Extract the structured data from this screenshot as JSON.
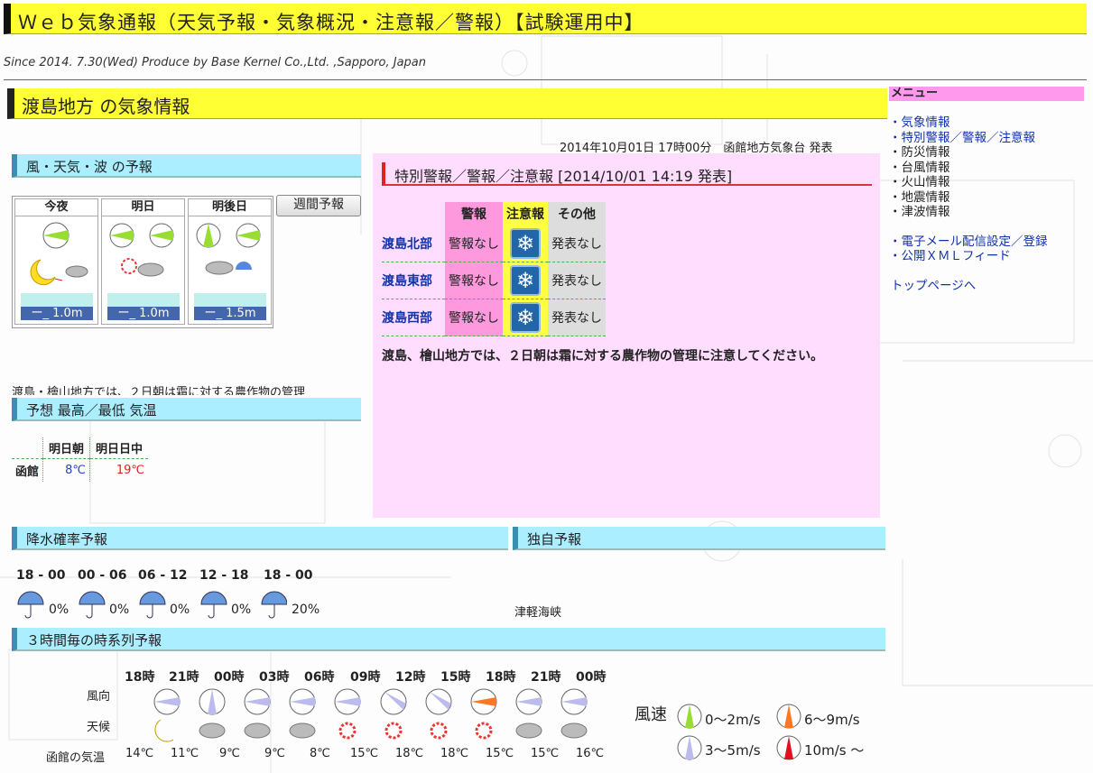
{
  "header": {
    "title": "Ｗｅｂ気象通報（天気予報・気象概況・注意報／警報）【試験運用中】",
    "subtitle": "Since 2014. 7.30(Wed) Produce by Base Kernel Co.,Ltd. ,Sapporo, Japan"
  },
  "region": {
    "title": "渡島地方 の気象情報",
    "issued": "2014年10月01日 17時00分　函館地方気象台 発表"
  },
  "menu": {
    "title": "メニュー",
    "items": [
      "・気象情報",
      "・特別警報／警報／注意報",
      "・防災情報",
      "・台風情報",
      "・火山情報",
      "・地震情報",
      "・津波情報"
    ],
    "links2": [
      "・電子メール配信設定／登録",
      "・公開ＸＭＬフィード"
    ],
    "top_link": "トップページへ"
  },
  "forecast": {
    "title": "風・天気・波 の予報",
    "week_button": "週間予報",
    "days": [
      {
        "label": "今夜",
        "wave": "1.0m",
        "weather": "moon-cloud"
      },
      {
        "label": "明日",
        "wave": "1.0m",
        "weather": "sun-cloud"
      },
      {
        "label": "明後日",
        "wave": "1.5m",
        "weather": "cloud-rain"
      }
    ],
    "cut_text": "渡島・檜山地方では、２日朝は霜に対する農作物の管理"
  },
  "warnings": {
    "title": "特別警報／警報／注意報 [2014/10/01 14:19 発表]",
    "headers": [
      "警報",
      "注意報",
      "その他"
    ],
    "rows": [
      {
        "area": "渡島北部",
        "warning": "警報なし",
        "other": "発表なし"
      },
      {
        "area": "渡島東部",
        "warning": "警報なし",
        "other": "発表なし"
      },
      {
        "area": "渡島西部",
        "warning": "警報なし",
        "other": "発表なし"
      }
    ],
    "note": "渡島、檜山地方では、２日朝は霜に対する農作物の管理に注意してください。"
  },
  "temps": {
    "title": "予想 最高／最低 気温",
    "headers": [
      "明日朝",
      "明日日中"
    ],
    "city": "函館",
    "min": "8℃",
    "max": "19℃"
  },
  "pop": {
    "title": "降水確率予報",
    "periods": [
      "18 - 00",
      "00 - 06",
      "06 - 12",
      "12 - 18",
      "18 - 00"
    ],
    "values": [
      "0%",
      "0%",
      "0%",
      "0%",
      "20%"
    ]
  },
  "own": {
    "title": "独自予報",
    "text": "津軽海峡"
  },
  "series": {
    "title": "３時間毎の時系列予報",
    "row_labels": [
      "風向",
      "天候",
      "函館の気温"
    ],
    "hours": [
      "18時",
      "21時",
      "00時",
      "03時",
      "06時",
      "09時",
      "12時",
      "15時",
      "18時",
      "21時",
      "00時"
    ],
    "temps": [
      "14℃",
      "11℃",
      "9℃",
      "9℃",
      "8℃",
      "15℃",
      "18℃",
      "18℃",
      "15℃",
      "15℃",
      "16℃"
    ],
    "weather": [
      "moon",
      "cloud",
      "cloud",
      "cloud",
      "sun",
      "sun",
      "sun",
      "sun",
      "cloud",
      "cloud",
      "cloud"
    ],
    "legend_title": "風速",
    "legend": [
      "0～2m/s",
      "6～9m/s",
      "3～5m/s",
      "10m/s ～"
    ]
  }
}
